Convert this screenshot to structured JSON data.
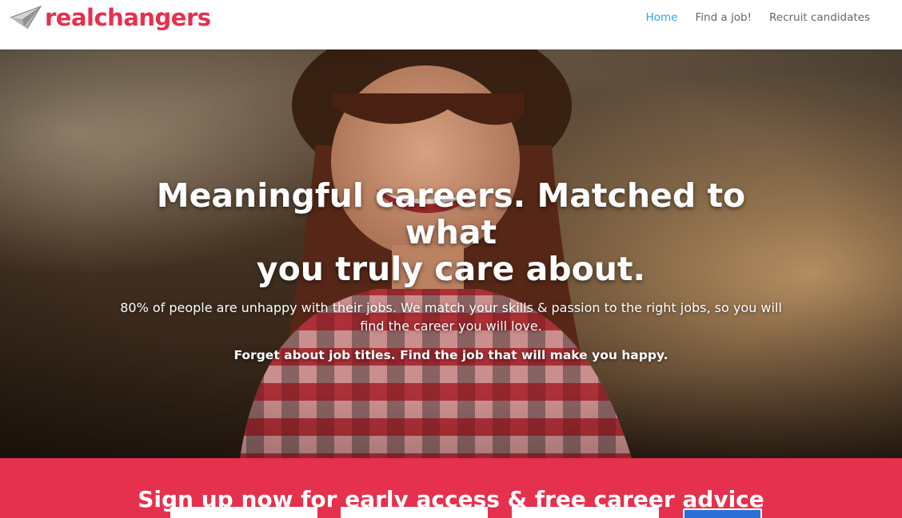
{
  "brand": {
    "name": "realchangers",
    "color": "#e5304e",
    "logo_icon": "paper-plane-icon"
  },
  "nav": {
    "items": [
      {
        "label": "Home",
        "active": true
      },
      {
        "label": "Find a job!",
        "active": false
      },
      {
        "label": "Recruit candidates",
        "active": false
      }
    ],
    "active_color": "#2ea3f2"
  },
  "hero": {
    "title_line1": "Meaningful careers. Matched to what",
    "title_line2": "you truly care about.",
    "subtitle": "80% of people are unhappy with their jobs. We match your skills & passion to the right jobs, so you will find the career you will love.",
    "tagline": "Forget about job titles. Find the job that will make you happy."
  },
  "signup": {
    "title": "Sign up now for early access & free career advice",
    "fields": [
      "",
      "",
      ""
    ],
    "background": "#e5304e",
    "button_color": "#2b6fd6"
  }
}
